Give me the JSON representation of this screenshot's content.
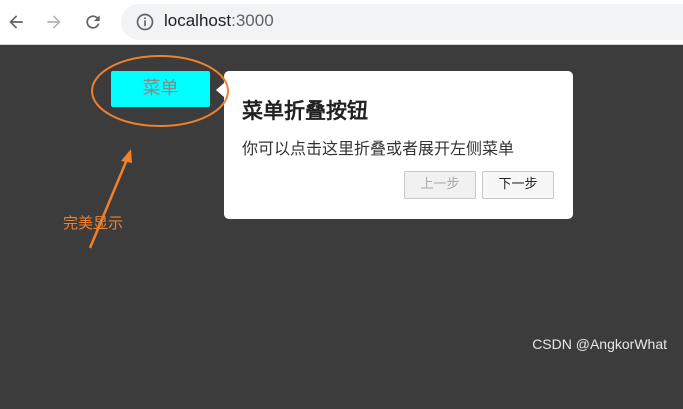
{
  "browser": {
    "back_icon": "arrow-left-icon",
    "forward_icon": "arrow-right-icon",
    "reload_icon": "reload-icon",
    "info_icon": "info-icon",
    "url_host": "localhost",
    "url_port": ":3000"
  },
  "page": {
    "menu_button_label": "菜单",
    "menu_button_color": "#00ffff"
  },
  "tour": {
    "title": "菜单折叠按钮",
    "description": "你可以点击这里折叠或者展开左侧菜单",
    "prev_label": "上一步",
    "next_label": "下一步"
  },
  "annotation": {
    "label": "完美显示",
    "color": "#f0802b"
  },
  "watermark": "CSDN @AngkorWhat"
}
